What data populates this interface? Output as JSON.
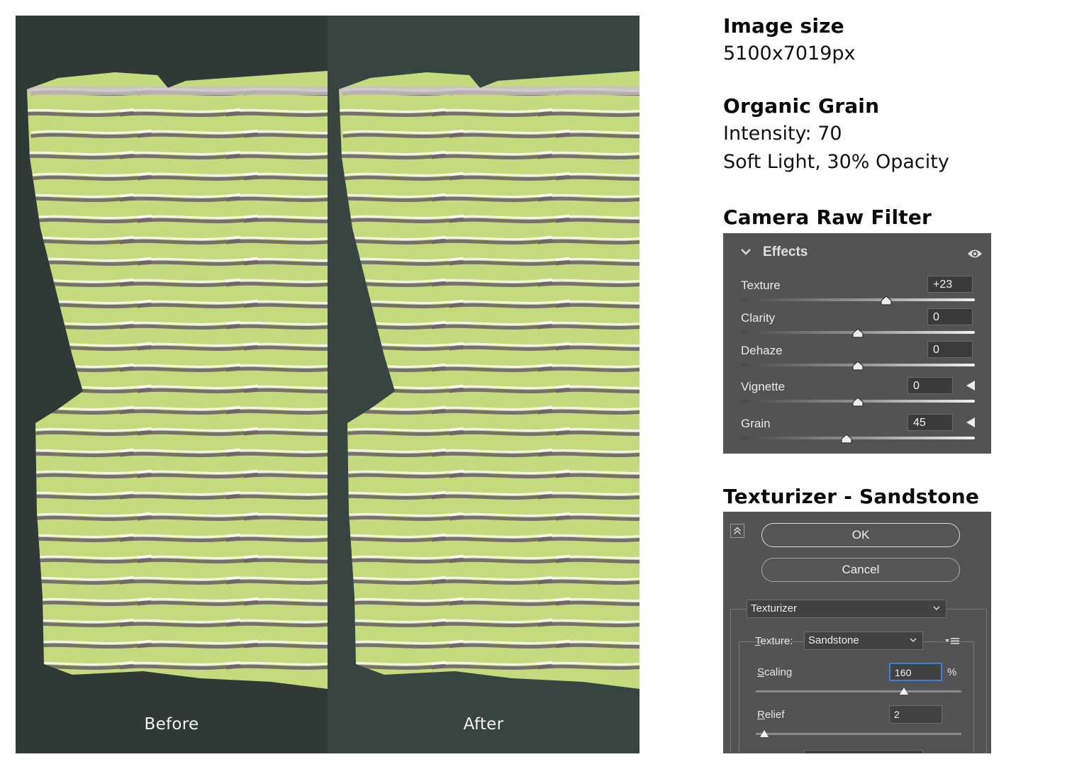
{
  "comparison": {
    "before_label": "Before",
    "after_label": "After",
    "colors": {
      "before_bg": "#2f3a37",
      "after_bg": "#38443f",
      "fabric": "#c5d97d",
      "stripe": "#6e6468",
      "stripe_light": "#c7bfc6"
    }
  },
  "info": {
    "image_size_title": "Image size",
    "image_size_value": "5100x7019px",
    "grain_title": "Organic Grain",
    "grain_intensity": "Intensity: 70",
    "grain_blend": "Soft Light, 30% Opacity",
    "camera_raw_title": "Camera Raw Filter",
    "texturizer_title": "Texturizer - Sandstone"
  },
  "camera_raw": {
    "section_title": "Effects",
    "section_icon": "chevron-down-icon",
    "visibility_icon": "eye-icon",
    "sliders": [
      {
        "label": "Texture",
        "value": "+23",
        "fraction": 0.62
      },
      {
        "label": "Clarity",
        "value": "0",
        "fraction": 0.5
      },
      {
        "label": "Dehaze",
        "value": "0",
        "fraction": 0.5
      },
      {
        "label": "Vignette",
        "value": "0",
        "fraction": 0.5,
        "has_arrow": true
      },
      {
        "label": "Grain",
        "value": "45",
        "fraction": 0.45,
        "has_arrow": true
      }
    ]
  },
  "texturizer": {
    "ok_label": "OK",
    "cancel_label": "Cancel",
    "filter_select": "Texturizer",
    "texture_label_prefix": "T",
    "texture_label_rest": "exture:",
    "texture_select": "Sandstone",
    "scaling_label_prefix": "S",
    "scaling_label_rest": "caling",
    "scaling_value": "160",
    "scaling_unit": "%",
    "scaling_fraction": 0.72,
    "relief_label_prefix": "R",
    "relief_label_rest": "elief",
    "relief_value": "2",
    "relief_fraction": 0.04
  }
}
